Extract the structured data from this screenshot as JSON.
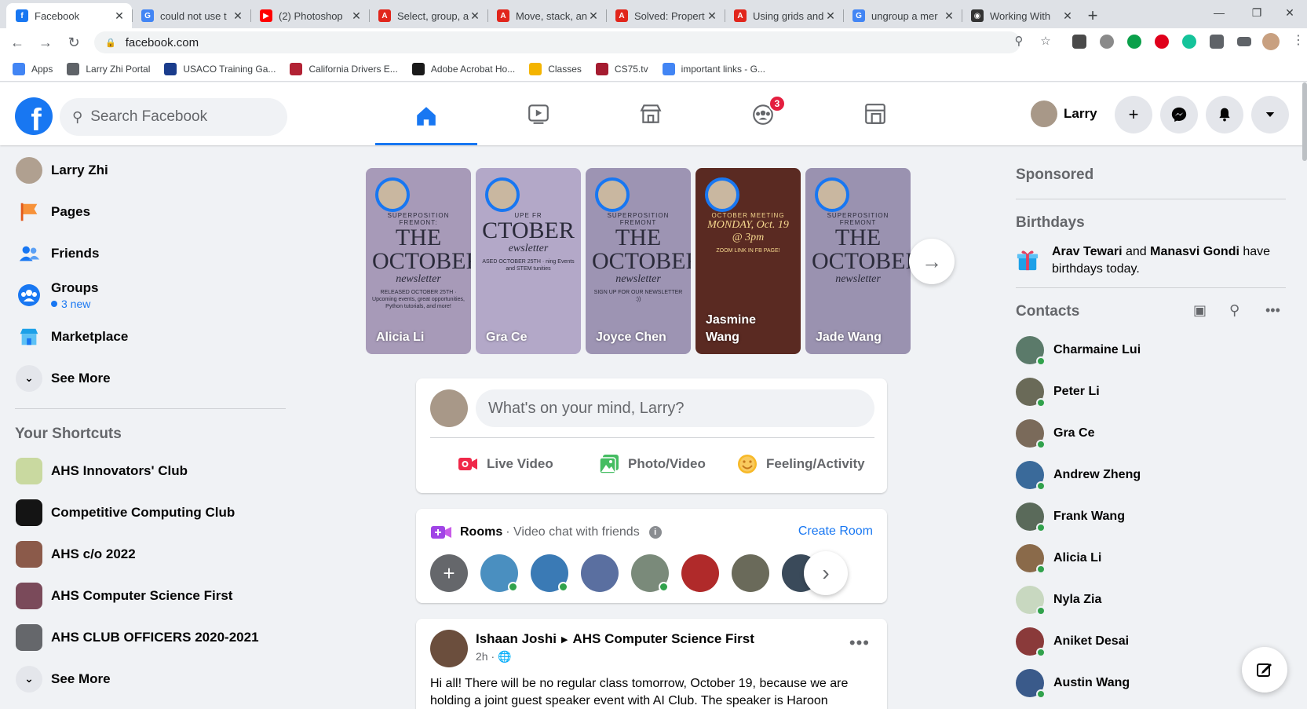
{
  "browser": {
    "tabs": [
      {
        "label": "Facebook",
        "icon": "facebook-icon",
        "color": "#1877f2",
        "glyph": "f",
        "active": true
      },
      {
        "label": "could not use t",
        "icon": "google-icon",
        "color": "#4285f4",
        "glyph": "G"
      },
      {
        "label": "(2) Photoshop",
        "icon": "youtube-icon",
        "color": "#ff0000",
        "glyph": "▶"
      },
      {
        "label": "Select, group, a",
        "icon": "adobe-icon",
        "color": "#e1251b",
        "glyph": "A"
      },
      {
        "label": "Move, stack, an",
        "icon": "adobe-icon",
        "color": "#e1251b",
        "glyph": "A"
      },
      {
        "label": "Solved: Propert",
        "icon": "adobe-icon",
        "color": "#e1251b",
        "glyph": "A"
      },
      {
        "label": "Using grids and",
        "icon": "adobe-icon",
        "color": "#e1251b",
        "glyph": "A"
      },
      {
        "label": "ungroup a mer",
        "icon": "google-icon",
        "color": "#4285f4",
        "glyph": "G"
      },
      {
        "label": "Working With",
        "icon": "web-icon",
        "color": "#333333",
        "glyph": "◉"
      }
    ],
    "url": "facebook.com",
    "bookmarks": [
      {
        "label": "Apps",
        "icon": "apps-grid-icon",
        "color": "#4285f4"
      },
      {
        "label": "Larry Zhi Portal",
        "icon": "globe-icon",
        "color": "#5f6368"
      },
      {
        "label": "USACO Training Ga...",
        "icon": "usaco-icon",
        "color": "#1a3c8c"
      },
      {
        "label": "California Drivers E...",
        "icon": "flag-icon",
        "color": "#b22234"
      },
      {
        "label": "Adobe Acrobat Ho...",
        "icon": "acrobat-icon",
        "color": "#1a1a1a"
      },
      {
        "label": "Classes",
        "icon": "classroom-icon",
        "color": "#f4b400"
      },
      {
        "label": "CS75.tv",
        "icon": "harvard-icon",
        "color": "#a51c30"
      },
      {
        "label": "important links - G...",
        "icon": "docs-icon",
        "color": "#4285f4"
      }
    ]
  },
  "header": {
    "search_placeholder": "Search Facebook",
    "groups_badge": "3",
    "profile_name": "Larry"
  },
  "leftnav": {
    "items": [
      {
        "label": "Larry Zhi",
        "icon": "profile-avatar"
      },
      {
        "label": "Pages",
        "icon": "pages-flag-icon"
      },
      {
        "label": "Friends",
        "icon": "friends-icon"
      },
      {
        "label": "Groups",
        "icon": "groups-icon",
        "sub": "3 new"
      },
      {
        "label": "Marketplace",
        "icon": "marketplace-icon"
      },
      {
        "label": "See More",
        "icon": "chevron-down-icon"
      }
    ],
    "shortcuts_title": "Your Shortcuts",
    "shortcuts": [
      {
        "label": "AHS Innovators' Club",
        "color": "#c9d9a0"
      },
      {
        "label": "Competitive Computing Club",
        "color": "#141414"
      },
      {
        "label": "AHS c/o 2022",
        "color": "#8b5a4a"
      },
      {
        "label": "AHS Computer Science First",
        "color": "#7a4a5a"
      },
      {
        "label": "AHS CLUB OFFICERS 2020-2021",
        "color": "#65676b"
      }
    ],
    "see_more": "See More"
  },
  "stories": [
    {
      "name": "Alicia Li",
      "bg": "#a79ab8",
      "poster_top": "SUPERPOSITION FREMONT:",
      "poster_title": "THE OCTOBER",
      "poster_sub": "newsletter",
      "poster_note": "RELEASED OCTOBER 25TH · Upcoming events, great opportunities, Python tutorials, and more!"
    },
    {
      "name": "Gra Ce",
      "bg": "#b3a8c8",
      "poster_top": "UPE FR",
      "poster_title": "CTOBER",
      "poster_sub": "ewsletter",
      "poster_note": "ASED OCTOBER 25TH · ning Events and STEM tunities"
    },
    {
      "name": "Joyce Chen",
      "bg": "#9d94b3",
      "poster_top": "SUPERPOSITION FREMONT",
      "poster_title": "THE OCTOBER",
      "poster_sub": "newsletter",
      "poster_note": "SIGN UP FOR OUR NEWSLETTER :))"
    },
    {
      "name": "Jasmine Wang",
      "bg": "#5a2a22",
      "poster_top": "OCTOBER MEETING",
      "poster_title": "",
      "poster_sub": "MONDAY, Oct. 19 @ 3pm",
      "poster_note": "ZOOM LINK IN FB PAGE!"
    },
    {
      "name": "Jade Wang",
      "bg": "#9a92b0",
      "poster_top": "SUPERPOSITION FREMONT",
      "poster_title": "THE OCTOBER",
      "poster_sub": "newsletter",
      "poster_note": ""
    }
  ],
  "composer": {
    "placeholder": "What's on your mind, Larry?",
    "actions": [
      {
        "label": "Live Video",
        "icon": "live-video-icon",
        "color": "#f02849"
      },
      {
        "label": "Photo/Video",
        "icon": "photo-icon",
        "color": "#45bd62"
      },
      {
        "label": "Feeling/Activity",
        "icon": "feeling-icon",
        "color": "#f7b928"
      }
    ]
  },
  "rooms": {
    "title": "Rooms",
    "subtitle": "· Video chat with friends",
    "create": "Create Room"
  },
  "post": {
    "author": "Ishaan Joshi",
    "group": "AHS Computer Science First",
    "time": "2h ·",
    "text": "Hi all! There will be no regular class tomorrow, October 19, because we are holding a joint guest speaker event with AI Club. The speaker is Haroon"
  },
  "right": {
    "sponsored": "Sponsored",
    "birthdays_title": "Birthdays",
    "birthday_name1": "Arav Tewari",
    "birthday_and": " and ",
    "birthday_name2": "Manasvi Gondi",
    "birthday_rest": " have birthdays today.",
    "contacts_title": "Contacts",
    "contacts": [
      {
        "name": "Charmaine Lui",
        "color": "#5b7a6a"
      },
      {
        "name": "Peter Li",
        "color": "#6a6a58"
      },
      {
        "name": "Gra Ce",
        "color": "#7a6a5a"
      },
      {
        "name": "Andrew Zheng",
        "color": "#3a6a9a"
      },
      {
        "name": "Frank Wang",
        "color": "#5a6a5a"
      },
      {
        "name": "Alicia Li",
        "color": "#8a6a4a"
      },
      {
        "name": "Nyla Zia",
        "color": "#c8d8c0"
      },
      {
        "name": "Aniket Desai",
        "color": "#8a3a3a"
      },
      {
        "name": "Austin Wang",
        "color": "#3a5a8a"
      }
    ]
  }
}
